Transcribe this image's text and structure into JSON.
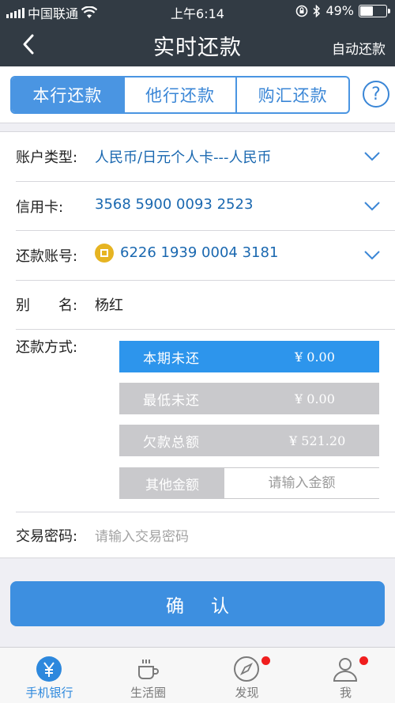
{
  "status_bar": {
    "carrier": "中国联通",
    "time": "上午6:14",
    "battery": "49%",
    "battery_level": 0.49
  },
  "nav": {
    "title": "实时还款",
    "action": "自动还款"
  },
  "tabs": [
    {
      "label": "本行还款",
      "active": true
    },
    {
      "label": "他行还款",
      "active": false
    },
    {
      "label": "购汇还款",
      "active": false
    }
  ],
  "help_icon": "question-circle-icon",
  "form": {
    "account_type": {
      "label": "账户类型:",
      "value": "人民币/日元个人卡---人民币"
    },
    "credit_card": {
      "label": "信用卡:",
      "value": "3568 5900 0093 2523"
    },
    "repay_account": {
      "label": "还款账号:",
      "value": "6226 1939 0004 3181"
    },
    "name": {
      "label": "别　　名:",
      "value": "杨红"
    },
    "repay_method": {
      "label": "还款方式:",
      "options": [
        {
          "name": "本期未还",
          "amount": "¥ 0.00",
          "selected": true
        },
        {
          "name": "最低未还",
          "amount": "¥ 0.00",
          "selected": false
        },
        {
          "name": "欠款总额",
          "amount": "¥ 521.20",
          "selected": false
        }
      ],
      "other": {
        "name": "其他金额",
        "placeholder": "请输入金额"
      }
    },
    "password": {
      "label": "交易密码:",
      "placeholder": "请输入交易密码"
    }
  },
  "confirm_label": "确认",
  "tabbar": [
    {
      "label": "手机银行",
      "icon": "yen-circle-icon",
      "active": true,
      "badge": false
    },
    {
      "label": "生活圈",
      "icon": "coffee-cup-icon",
      "active": false,
      "badge": false
    },
    {
      "label": "发现",
      "icon": "compass-icon",
      "active": false,
      "badge": true
    },
    {
      "label": "我",
      "icon": "person-icon",
      "active": false,
      "badge": true
    }
  ],
  "colors": {
    "accent": "#2d95ec",
    "navbar": "#323b44",
    "badge": "#f01e1e",
    "link_text": "#1a68b0"
  }
}
